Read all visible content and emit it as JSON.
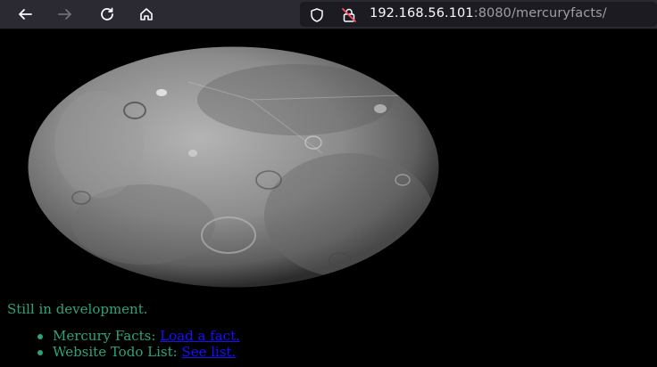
{
  "browser": {
    "back_icon": "arrow-left-icon",
    "forward_icon": "arrow-right-icon",
    "reload_icon": "reload-icon",
    "home_icon": "home-icon",
    "url_host": "192.168.56.101",
    "url_rest": ":8080/mercuryfacts/"
  },
  "page": {
    "image_subject": "planet Mercury",
    "status_text": "Still in development.",
    "items": [
      {
        "label": "Mercury Facts: ",
        "link": "Load a fact."
      },
      {
        "label": "Website Todo List: ",
        "link": "See list."
      }
    ]
  },
  "colors": {
    "background": "#000000",
    "text": "#2ea37a",
    "link": "#1a0dff",
    "toolbar": "#2b2a33"
  }
}
